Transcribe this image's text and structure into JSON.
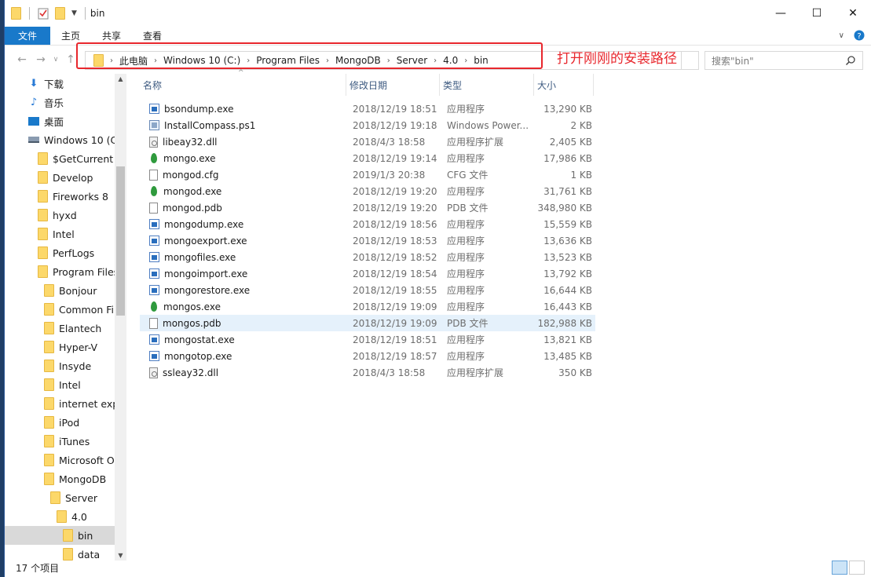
{
  "window": {
    "title": "bin",
    "controls": {
      "minimize": "—",
      "maximize": "☐",
      "close": "✕"
    }
  },
  "ribbon": {
    "tabs": [
      "文件",
      "主页",
      "共享",
      "查看"
    ]
  },
  "nav": {
    "breadcrumbs": [
      "此电脑",
      "Windows 10 (C:)",
      "Program Files",
      "MongoDB",
      "Server",
      "4.0",
      "bin"
    ],
    "search_placeholder": "搜索\"bin\""
  },
  "annotation": {
    "text": "打开刚刚的安装路径",
    "color": "#e8272d"
  },
  "tree": {
    "items": [
      {
        "label": "下载",
        "icon": "download-icon",
        "indent": 30
      },
      {
        "label": "音乐",
        "icon": "music-icon",
        "indent": 30
      },
      {
        "label": "桌面",
        "icon": "desktop-icon",
        "indent": 30
      },
      {
        "label": "Windows 10 (C",
        "icon": "drive-icon",
        "indent": 30
      },
      {
        "label": "$GetCurrent",
        "icon": "folder-icon",
        "indent": 42
      },
      {
        "label": "Develop",
        "icon": "folder-icon",
        "indent": 42
      },
      {
        "label": "Fireworks 8",
        "icon": "folder-icon",
        "indent": 42
      },
      {
        "label": "hyxd",
        "icon": "folder-icon",
        "indent": 42
      },
      {
        "label": "Intel",
        "icon": "folder-icon",
        "indent": 42
      },
      {
        "label": "PerfLogs",
        "icon": "folder-icon",
        "indent": 42
      },
      {
        "label": "Program Files",
        "icon": "folder-icon",
        "indent": 42
      },
      {
        "label": "Bonjour",
        "icon": "folder-icon",
        "indent": 50
      },
      {
        "label": "Common Fil",
        "icon": "folder-icon",
        "indent": 50
      },
      {
        "label": "Elantech",
        "icon": "folder-icon",
        "indent": 50
      },
      {
        "label": "Hyper-V",
        "icon": "folder-icon",
        "indent": 50
      },
      {
        "label": "Insyde",
        "icon": "folder-icon",
        "indent": 50
      },
      {
        "label": "Intel",
        "icon": "folder-icon",
        "indent": 50
      },
      {
        "label": "internet exp",
        "icon": "folder-icon",
        "indent": 50
      },
      {
        "label": "iPod",
        "icon": "folder-icon",
        "indent": 50
      },
      {
        "label": "iTunes",
        "icon": "folder-icon",
        "indent": 50
      },
      {
        "label": "Microsoft O",
        "icon": "folder-icon",
        "indent": 50
      },
      {
        "label": "MongoDB",
        "icon": "folder-icon",
        "indent": 50
      },
      {
        "label": "Server",
        "icon": "folder-icon",
        "indent": 58
      },
      {
        "label": "4.0",
        "icon": "folder-icon",
        "indent": 66
      },
      {
        "label": "bin",
        "icon": "folder-icon",
        "indent": 74,
        "selected": true
      },
      {
        "label": "data",
        "icon": "folder-icon",
        "indent": 74
      }
    ]
  },
  "columns": {
    "name": "名称",
    "date": "修改日期",
    "type": "类型",
    "size": "大小"
  },
  "files": [
    {
      "name": "bsondump.exe",
      "date": "2018/12/19 18:51",
      "type": "应用程序",
      "size": "13,290 KB",
      "icon": "exe"
    },
    {
      "name": "InstallCompass.ps1",
      "date": "2018/12/19 19:18",
      "type": "Windows Power...",
      "size": "2 KB",
      "icon": "ps1"
    },
    {
      "name": "libeay32.dll",
      "date": "2018/4/3 18:58",
      "type": "应用程序扩展",
      "size": "2,405 KB",
      "icon": "dll"
    },
    {
      "name": "mongo.exe",
      "date": "2018/12/19 19:14",
      "type": "应用程序",
      "size": "17,986 KB",
      "icon": "leaf"
    },
    {
      "name": "mongod.cfg",
      "date": "2019/1/3 20:38",
      "type": "CFG 文件",
      "size": "1 KB",
      "icon": "doc"
    },
    {
      "name": "mongod.exe",
      "date": "2018/12/19 19:20",
      "type": "应用程序",
      "size": "31,761 KB",
      "icon": "leaf"
    },
    {
      "name": "mongod.pdb",
      "date": "2018/12/19 19:20",
      "type": "PDB 文件",
      "size": "348,980 KB",
      "icon": "doc"
    },
    {
      "name": "mongodump.exe",
      "date": "2018/12/19 18:56",
      "type": "应用程序",
      "size": "15,559 KB",
      "icon": "exe"
    },
    {
      "name": "mongoexport.exe",
      "date": "2018/12/19 18:53",
      "type": "应用程序",
      "size": "13,636 KB",
      "icon": "exe"
    },
    {
      "name": "mongofiles.exe",
      "date": "2018/12/19 18:52",
      "type": "应用程序",
      "size": "13,523 KB",
      "icon": "exe"
    },
    {
      "name": "mongoimport.exe",
      "date": "2018/12/19 18:54",
      "type": "应用程序",
      "size": "13,792 KB",
      "icon": "exe"
    },
    {
      "name": "mongorestore.exe",
      "date": "2018/12/19 18:55",
      "type": "应用程序",
      "size": "16,644 KB",
      "icon": "exe"
    },
    {
      "name": "mongos.exe",
      "date": "2018/12/19 19:09",
      "type": "应用程序",
      "size": "16,443 KB",
      "icon": "leaf"
    },
    {
      "name": "mongos.pdb",
      "date": "2018/12/19 19:09",
      "type": "PDB 文件",
      "size": "182,988 KB",
      "icon": "doc",
      "hover": true
    },
    {
      "name": "mongostat.exe",
      "date": "2018/12/19 18:51",
      "type": "应用程序",
      "size": "13,821 KB",
      "icon": "exe"
    },
    {
      "name": "mongotop.exe",
      "date": "2018/12/19 18:57",
      "type": "应用程序",
      "size": "13,485 KB",
      "icon": "exe"
    },
    {
      "name": "ssleay32.dll",
      "date": "2018/4/3 18:58",
      "type": "应用程序扩展",
      "size": "350 KB",
      "icon": "dll"
    }
  ],
  "status": {
    "item_count": "17 个项目"
  }
}
